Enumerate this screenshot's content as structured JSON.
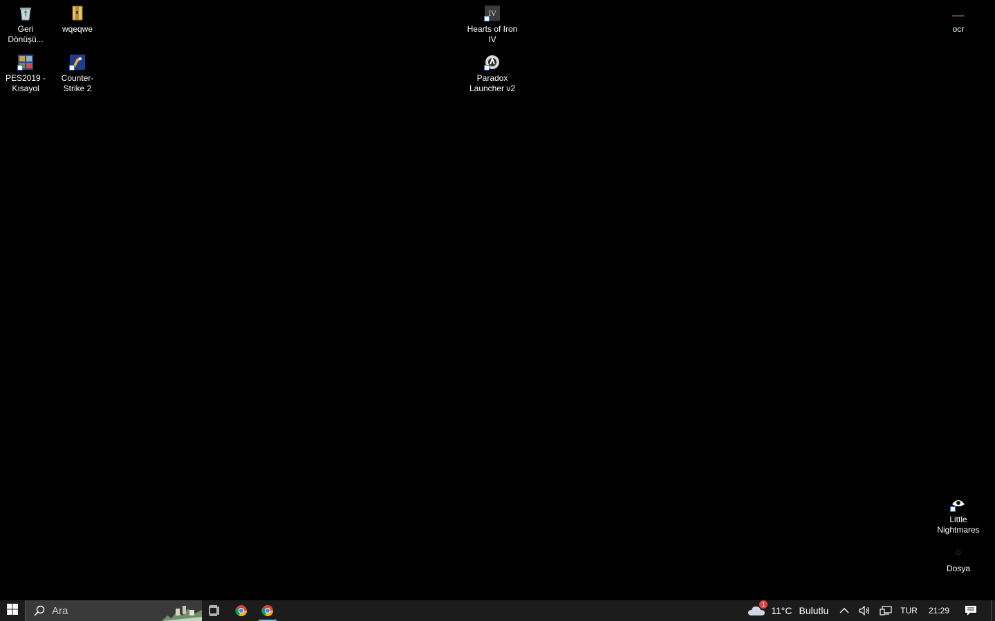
{
  "desktop": {
    "icons": [
      {
        "label": "Geri Dönüşü...",
        "icon": "recycle-bin-icon"
      },
      {
        "label": "wqeqwe",
        "icon": "archive-icon"
      },
      {
        "label": "PES2019 - Kısayol",
        "icon": "pes-game-icon"
      },
      {
        "label": "Counter-Strike 2",
        "icon": "counter-strike-icon"
      },
      {
        "label": "Hearts of Iron IV",
        "icon": "hearts-of-iron-icon"
      },
      {
        "label": "Paradox Launcher v2",
        "icon": "paradox-launcher-icon"
      },
      {
        "label": "ocr",
        "icon": "ocr-icon"
      },
      {
        "label": "Little Nightmares",
        "icon": "little-nightmares-icon"
      },
      {
        "label": "Dosya",
        "icon": "file-icon"
      }
    ]
  },
  "taskbar": {
    "search_placeholder": "Ara",
    "pinned": [
      {
        "name": "task-view",
        "icon": "task-view-icon"
      },
      {
        "name": "chrome",
        "icon": "chrome-icon"
      },
      {
        "name": "chrome-active",
        "icon": "chrome-icon",
        "active": true
      }
    ],
    "weather": {
      "temp": "11°C",
      "condition": "Bulutlu",
      "badge": "1"
    },
    "language": "TUR",
    "time": "21:29"
  },
  "colors": {
    "desktop_bg": "#000000",
    "taskbar_bg": "#1c1c1c",
    "search_bg": "#3a3a3a",
    "accent": "#76b9ed"
  }
}
